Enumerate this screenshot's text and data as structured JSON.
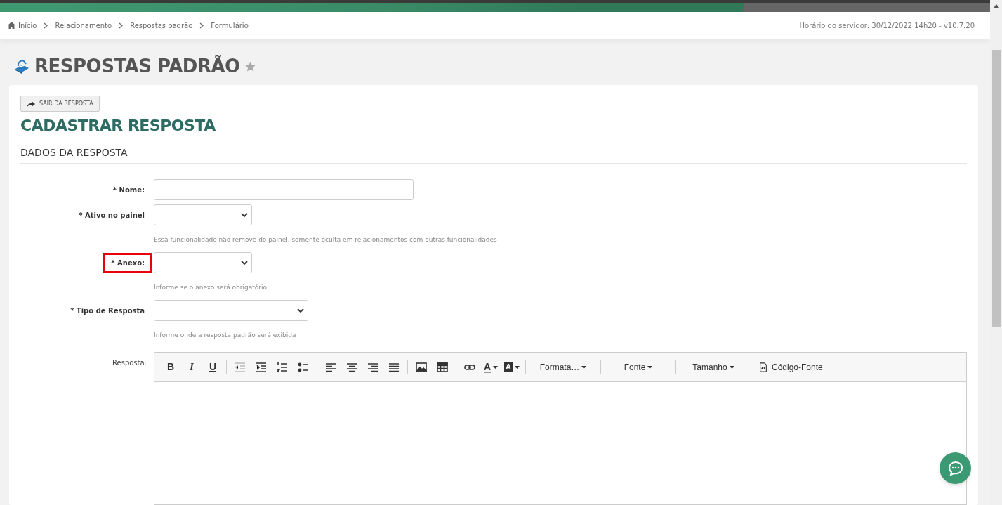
{
  "breadcrumb": [
    {
      "label": "Início"
    },
    {
      "label": "Relacionamento"
    },
    {
      "label": "Respostas padrão"
    },
    {
      "label": "Formulário"
    }
  ],
  "server_time": "Horário do servidor: 30/12/2022 14h20 - v10.7.20",
  "page_title": "RESPOSTAS PADRÃO",
  "favorite": false,
  "exit_button": "SAIR DA RESPOSTA",
  "form_title": "CADASTRAR RESPOSTA",
  "section_title": "DADOS DA RESPOSTA",
  "fields": [
    {
      "kind": "text",
      "label": "Nome:",
      "required_mark": "*",
      "highlighted": false
    },
    {
      "kind": "select",
      "label": "Ativo no painel",
      "required_mark": "*",
      "highlighted": false,
      "hint": "Essa funcionalidade não remove do painel, somente oculta em relacionamentos com outras funcionalidades"
    },
    {
      "kind": "select",
      "label": "Anexo:",
      "required_mark": "*",
      "highlighted": true,
      "hint": "Informe se o anexo será obrigatório"
    },
    {
      "kind": "select-wide",
      "label": "Tipo de Resposta",
      "required_mark": "*",
      "highlighted": false,
      "hint": "Informe onde a resposta padrão será exibida"
    }
  ],
  "editor": {
    "label": "Resposta:",
    "toolbar": [
      {
        "kind": "bold",
        "label": "B"
      },
      {
        "kind": "italic",
        "label": "I"
      },
      {
        "kind": "underline",
        "label": "U"
      },
      {
        "kind": "separator"
      },
      {
        "kind": "outdent",
        "disabled": true
      },
      {
        "kind": "indent",
        "disabled": false
      },
      {
        "kind": "numbered-list",
        "disabled": false
      },
      {
        "kind": "bullet-list",
        "disabled": false
      },
      {
        "kind": "separator"
      },
      {
        "kind": "align-left",
        "disabled": false
      },
      {
        "kind": "align-center",
        "disabled": false
      },
      {
        "kind": "align-right",
        "disabled": false
      },
      {
        "kind": "justify",
        "disabled": false
      },
      {
        "kind": "separator"
      },
      {
        "kind": "image",
        "disabled": false
      },
      {
        "kind": "table",
        "disabled": false
      },
      {
        "kind": "separator"
      },
      {
        "kind": "link",
        "disabled": false
      },
      {
        "kind": "text-color",
        "label": "A"
      },
      {
        "kind": "background-color",
        "label": "A"
      },
      {
        "kind": "separator"
      },
      {
        "kind": "dropdown",
        "label": "Formata…"
      },
      {
        "kind": "separator"
      },
      {
        "kind": "dropdown",
        "label": "Fonte"
      },
      {
        "kind": "separator"
      },
      {
        "kind": "dropdown",
        "label": "Tamanho"
      },
      {
        "kind": "separator"
      },
      {
        "kind": "source",
        "label": "Código-Fonte"
      }
    ]
  }
}
